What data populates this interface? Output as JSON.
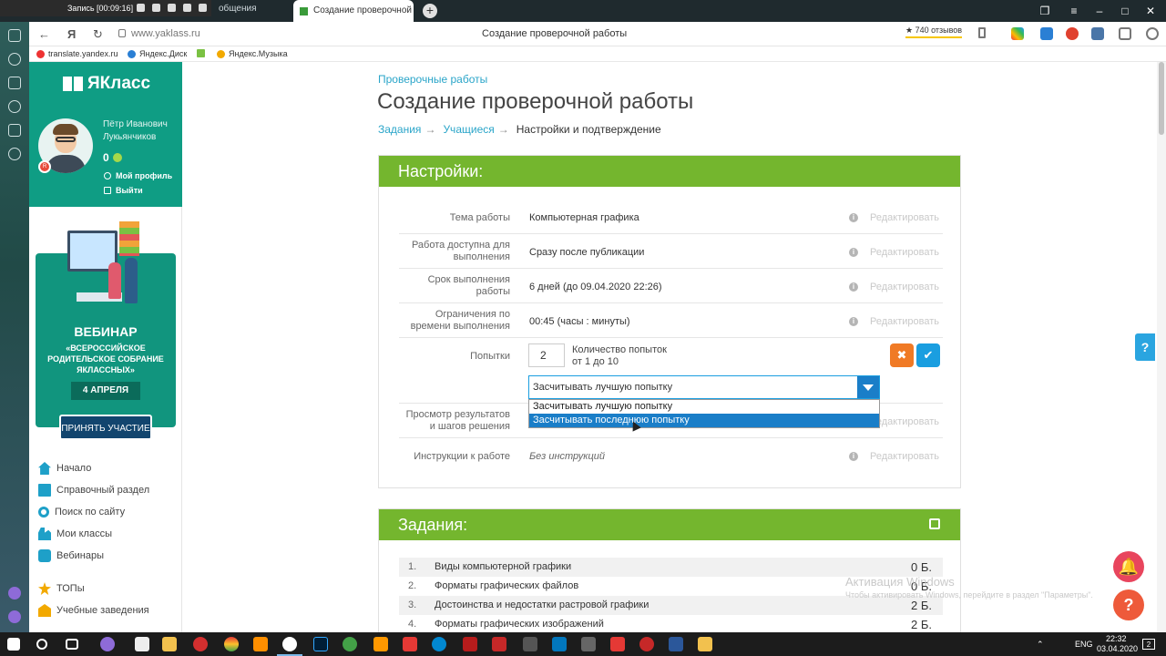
{
  "browser": {
    "recording_label": "Запись [00:09:16]",
    "old_tab_label": "общения",
    "active_tab_label": "Создание проверочной",
    "url": "www.yaklass.ru",
    "page_title": "Создание проверочной работы",
    "reviews": "★ 740 отзывов",
    "bookmarks": [
      "translate.yandex.ru",
      "Яндекс.Диск",
      "Яндекс.Музыка"
    ]
  },
  "site": {
    "logo": "ЯКласс",
    "user": {
      "first": "Пётр Иванович",
      "last": "Лукьянчиков",
      "score": "0",
      "profile": "Мой профиль",
      "logout": "Выйти"
    },
    "promo": {
      "title": "ВЕБИНАР",
      "subtitle": "«ВСЕРОССИЙСКОЕ РОДИТЕЛЬСКОЕ СОБРАНИЕ ЯКЛАССНЫХ»",
      "date": "4 АПРЕЛЯ",
      "button": "ПРИНЯТЬ УЧАСТИЕ"
    },
    "menu": [
      {
        "label": "Начало",
        "icon": "home-icon",
        "color": "#1ea0c8"
      },
      {
        "label": "Справочный раздел",
        "icon": "book-icon",
        "color": "#1ea0c8"
      },
      {
        "label": "Поиск по сайту",
        "icon": "search-icon",
        "color": "#1ea0c8"
      },
      {
        "label": "Мои классы",
        "icon": "users-icon",
        "color": "#1ea0c8"
      },
      {
        "label": "Вебинары",
        "icon": "video-icon",
        "color": "#1ea0c8"
      }
    ],
    "menu2": [
      {
        "label": "ТОПы",
        "icon": "star-icon",
        "color": "#f2a900"
      },
      {
        "label": "Учебные заведения",
        "icon": "school-icon",
        "color": "#f2a900"
      }
    ]
  },
  "main": {
    "breadcrumb_top": "Проверочные работы",
    "title": "Создание проверочной работы",
    "steps": {
      "step1": "Задания",
      "step2": "Учащиеся",
      "step3": "Настройки и подтверждение",
      "arrow": "→"
    },
    "settings": {
      "header": "Настройки:",
      "edit_label": "Редактировать",
      "rows": [
        {
          "label": "Тема работы",
          "value": "Компьютерная графика"
        },
        {
          "label": "Работа доступна для выполнения",
          "value": "Сразу после публикации"
        },
        {
          "label": "Срок выполнения работы",
          "value": "6 дней (до 09.04.2020 22:26)"
        },
        {
          "label": "Ограничения по времени выполнения",
          "value": "00:45 (часы : минуты)"
        }
      ],
      "attempts": {
        "label": "Попытки",
        "value": "2",
        "hint1": "Количество попыток",
        "hint2": "от 1 до 10",
        "cancel": "✖",
        "ok": "✔",
        "select_value": "Засчитывать лучшую попытку",
        "options": [
          "Засчитывать лучшую попытку",
          "Засчитывать последнюю попытку"
        ],
        "highlighted_option": "Засчитывать последнюю попытку"
      },
      "rows_after": [
        {
          "label": "Просмотр результатов и шагов решения",
          "value": ""
        },
        {
          "label": "Инструкции к работе",
          "value": "Без инструкций"
        }
      ]
    },
    "tasks": {
      "header": "Задания:",
      "items": [
        {
          "num": "1.",
          "name": "Виды компьютерной графики",
          "points": "0 Б."
        },
        {
          "num": "2.",
          "name": "Форматы графических файлов",
          "points": "0 Б."
        },
        {
          "num": "3.",
          "name": "Достоинства и недостатки растровой графики",
          "points": "2 Б."
        },
        {
          "num": "4.",
          "name": "Форматы графических изображений",
          "points": "2 Б."
        }
      ]
    }
  },
  "overlay": {
    "watermark_title": "Активация Windows",
    "watermark_text": "Чтобы активировать Windows, перейдите в раздел \"Параметры\".",
    "help": "?",
    "fab_help": "?"
  },
  "taskbar": {
    "lang": "ENG",
    "time": "22:32",
    "date": "03.04.2020",
    "notifications": "2"
  }
}
